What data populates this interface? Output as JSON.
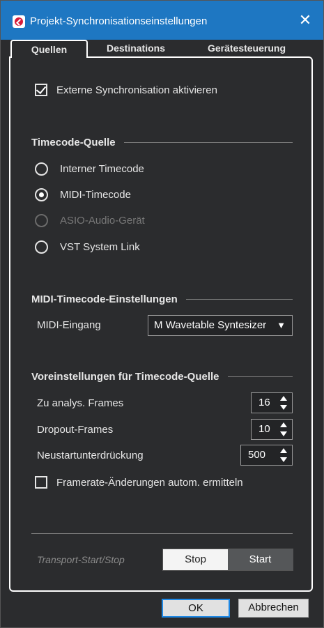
{
  "window": {
    "title": "Projekt-Synchronisationseinstellungen",
    "accent_color": "#1e77c2",
    "app_icon": "cubase-icon",
    "close_icon": "close-icon"
  },
  "tabs": [
    {
      "label": "Quellen",
      "active": true
    },
    {
      "label": "Destinations",
      "active": false
    },
    {
      "label": "Gerätesteuerung",
      "active": false
    }
  ],
  "external_sync": {
    "label": "Externe Synchronisation aktivieren",
    "checked": true
  },
  "timecode_source": {
    "heading": "Timecode-Quelle",
    "options": [
      {
        "label": "Interner Timecode",
        "selected": false,
        "disabled": false
      },
      {
        "label": "MIDI-Timecode",
        "selected": true,
        "disabled": false
      },
      {
        "label": "ASIO-Audio-Gerät",
        "selected": false,
        "disabled": true
      },
      {
        "label": "VST System Link",
        "selected": false,
        "disabled": false
      }
    ]
  },
  "midi_timecode": {
    "heading": "MIDI-Timecode-Einstellungen",
    "input_label": "MIDI-Eingang",
    "input_value": "M Wavetable Syntesizer",
    "dropdown_arrow": "▼"
  },
  "presets": {
    "heading": "Voreinstellungen für Timecode-Quelle",
    "analyze_frames_label": "Zu analys. Frames",
    "analyze_frames_value": "16",
    "dropout_frames_label": "Dropout-Frames",
    "dropout_frames_value": "10",
    "restart_suppression_label": "Neustartunterdrückung",
    "restart_suppression_value": "500",
    "framerate_label": "Framerate-Änderungen autom. ermitteln",
    "framerate_checked": false
  },
  "transport": {
    "label": "Transport-Start/Stop",
    "stop_label": "Stop",
    "start_label": "Start",
    "selected": "Stop"
  },
  "buttons": {
    "ok_label": "OK",
    "cancel_label": "Abbrechen"
  }
}
